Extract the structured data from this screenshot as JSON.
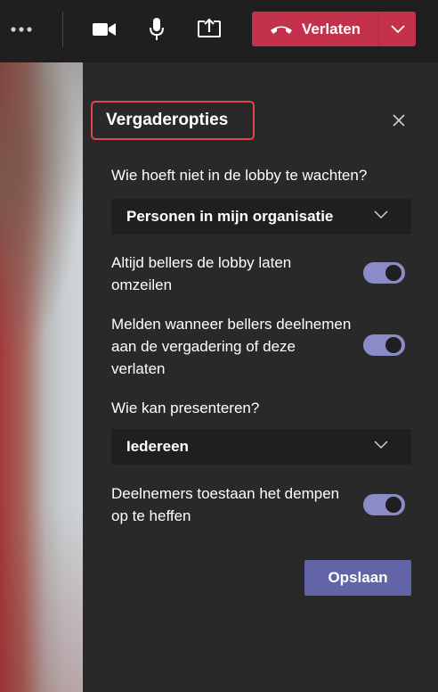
{
  "toolbar": {
    "more_icon": "more-dots-icon",
    "camera_icon": "video-camera-icon",
    "mic_icon": "microphone-icon",
    "share_icon": "share-screen-icon",
    "leave_label": "Verlaten",
    "leave_color": "#c4314b"
  },
  "panel": {
    "title": "Vergaderopties",
    "lobby_question": "Wie hoeft niet in de lobby te wachten?",
    "lobby_select_value": "Personen in mijn organisatie",
    "bypass_lobby_label": "Altijd bellers de lobby laten omzeilen",
    "bypass_lobby_on": true,
    "announce_label": "Melden wanneer bellers deelnemen aan de vergadering of deze verlaten",
    "announce_on": true,
    "presenter_question": "Wie kan presenteren?",
    "presenter_select_value": "Iedereen",
    "unmute_label": "Deelnemers toestaan het dempen op te heffen",
    "unmute_on": true,
    "save_label": "Opslaan",
    "accent_color": "#6264a7",
    "toggle_color": "#8b8cc7",
    "highlight_color": "#e2434f"
  }
}
